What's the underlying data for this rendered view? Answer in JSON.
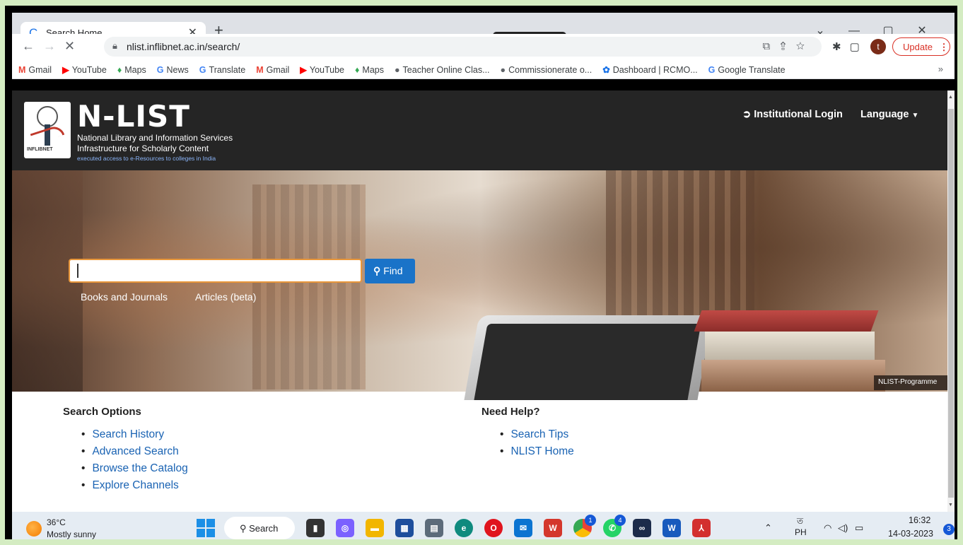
{
  "browser": {
    "tab_title": "Search Home",
    "tab_close": "✕",
    "new_tab": "+",
    "capture_toolbar": "📷■⊡⚙",
    "window_controls": [
      "⌄",
      "—",
      "▢",
      "✕"
    ],
    "url": "nlist.inflibnet.ac.in/search/",
    "update_label": "Update",
    "avatar_letter": "t",
    "bookmarks": [
      {
        "icon": "M",
        "icon_color": "#ea4335",
        "label": "Gmail"
      },
      {
        "icon": "▶",
        "icon_color": "#ff0000",
        "label": "YouTube"
      },
      {
        "icon": "♦",
        "icon_color": "#34a853",
        "label": "Maps"
      },
      {
        "icon": "G",
        "icon_color": "#4285f4",
        "label": "News"
      },
      {
        "icon": "G",
        "icon_color": "#4285f4",
        "label": "Translate"
      },
      {
        "icon": "M",
        "icon_color": "#ea4335",
        "label": "Gmail"
      },
      {
        "icon": "▶",
        "icon_color": "#ff0000",
        "label": "YouTube"
      },
      {
        "icon": "♦",
        "icon_color": "#34a853",
        "label": "Maps"
      },
      {
        "icon": "●",
        "icon_color": "#5f6368",
        "label": "Teacher Online Clas..."
      },
      {
        "icon": "●",
        "icon_color": "#5f6368",
        "label": "Commissionerate o..."
      },
      {
        "icon": "✿",
        "icon_color": "#1a73e8",
        "label": "Dashboard | RCMO..."
      },
      {
        "icon": "G",
        "icon_color": "#4285f4",
        "label": "Google Translate"
      }
    ],
    "bookmarks_more": "»"
  },
  "site": {
    "brand": "N-LIST",
    "logo_text": "INFLIBNET",
    "tagline_1": "National Library and Information Services",
    "tagline_2": "Infrastructure for Scholarly Content",
    "tagline_3": "executed access to e-Resources to colleges in India",
    "login_label": "Institutional Login",
    "language_label": "Language",
    "find_label": "Find",
    "scope_books": "Books and Journals",
    "scope_articles": "Articles (beta)",
    "image_credit": "NLIST-Programme",
    "search_options_heading": "Search Options",
    "search_options": [
      "Search History",
      "Advanced Search",
      "Browse the Catalog",
      "Explore Channels"
    ],
    "help_heading": "Need Help?",
    "help_links": [
      "Search Tips",
      "NLIST Home"
    ]
  },
  "taskbar": {
    "temperature": "36°C",
    "weather": "Mostly sunny",
    "search_label": "Search",
    "chrome_badge": "1",
    "whatsapp_badge": "4",
    "ime_top": "ত",
    "ime_bottom": "PH",
    "time": "16:32",
    "date": "14-03-2023",
    "notifications": "3"
  }
}
